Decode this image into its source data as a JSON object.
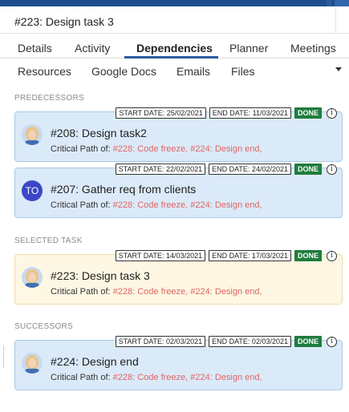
{
  "header": {
    "title": "#223: Design task 3"
  },
  "tabs_row1": [
    {
      "label": "Details"
    },
    {
      "label": "Activity"
    },
    {
      "label": "Dependencies"
    },
    {
      "label": "Planner"
    },
    {
      "label": "Meetings"
    }
  ],
  "tabs_row2": [
    {
      "label": "Resources"
    },
    {
      "label": "Google Docs"
    },
    {
      "label": "Emails"
    },
    {
      "label": "Files"
    }
  ],
  "active_tab": "Dependencies",
  "sections": {
    "predecessors": "PREDECESSORS",
    "selected": "SELECTED TASK",
    "successors": "SUCCESSORS"
  },
  "cards": [
    {
      "start": "START DATE: 25/02/2021",
      "end": "END DATE: 11/03/2021",
      "status": "DONE",
      "title": "#208: Design task2",
      "critical_label": "Critical Path of:",
      "critical_links": "#228: Code freeze, #224: Design end,",
      "avatar": "photo"
    },
    {
      "start": "START DATE: 22/02/2021",
      "end": "END DATE: 24/02/2021",
      "status": "DONE",
      "title": "#207: Gather req from clients",
      "critical_label": "Critical Path of:",
      "critical_links": "#228: Code freeze, #224: Design end,",
      "avatar": "TO"
    },
    {
      "start": "START DATE: 14/03/2021",
      "end": "END DATE: 17/03/2021",
      "status": "DONE",
      "title": "#223: Design task 3",
      "critical_label": "Critical Path of:",
      "critical_links": "#228: Code freeze, #224: Design end,",
      "avatar": "photo"
    },
    {
      "start": "START DATE: 02/03/2021",
      "end": "END DATE: 02/03/2021",
      "status": "DONE",
      "title": "#224: Design end",
      "critical_label": "Critical Path of:",
      "critical_links": "#228: Code freeze, #224: Design end,",
      "avatar": "photo"
    }
  ],
  "icons": {
    "info": "info-icon",
    "more": "chevron-down-icon"
  },
  "colors": {
    "done_badge": "#1e7d3e",
    "card_blue": "#dbeaf8",
    "card_yellow": "#fdf7e3",
    "link_red": "#e06565",
    "tab_underline": "#2a5c9d"
  }
}
